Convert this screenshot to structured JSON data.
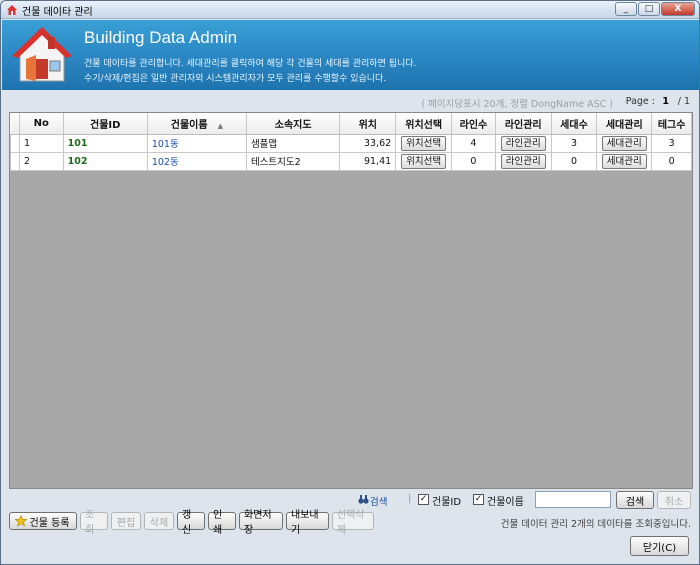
{
  "window": {
    "title": "건물 데이타 관리",
    "controls": [
      "_",
      "□",
      "X"
    ]
  },
  "banner": {
    "title": "Building Data Admin",
    "desc1": "건물 데이타를 관리합니다.  세대관리를 클릭하여 해당 각 건물의 세대를 관리하면 됩니다.",
    "desc2": "수기/삭제/편집은 일반 관리자외 시스템관리자가 모두 관리를 수행할수 있습니다."
  },
  "paging": {
    "sort_info": "( 페이지당표시 20개, 정렬 DongName ASC )",
    "page_label": "Page :",
    "current": "1",
    "total": "/  1"
  },
  "table": {
    "columns": [
      "No",
      "건물ID",
      "건물이름",
      "소속지도",
      "위치",
      "위치선택",
      "라인수",
      "라인관리",
      "세대수",
      "세대관리",
      "테그수"
    ],
    "sort_indicator": "▲",
    "rows": [
      {
        "no": "1",
        "id": "101",
        "name": "101동",
        "map": "샘플맵",
        "pos": "33,62",
        "pos_btn": "위치선택",
        "lines": "4",
        "line_btn": "라인관리",
        "units": "3",
        "unit_btn": "세대관리",
        "tags": "3"
      },
      {
        "no": "2",
        "id": "102",
        "name": "102동",
        "map": "테스트지도2",
        "pos": "91,41",
        "pos_btn": "위치선택",
        "lines": "0",
        "line_btn": "라인관리",
        "units": "0",
        "unit_btn": "세대관리",
        "tags": "0"
      }
    ]
  },
  "search": {
    "label": "검색",
    "pipe": "|",
    "opt_id": "건물ID",
    "opt_name": "건물이름",
    "check_mark": "✓",
    "value": "",
    "search_btn": "검색",
    "cancel_btn": "취소"
  },
  "toolbar": {
    "add": "건물 등록",
    "view": "조회",
    "edit": "편집",
    "delete": "삭제",
    "refresh": "갱신",
    "print": "인쇄",
    "save_screen": "화면저장",
    "export": "내보내기",
    "delete_selected": "선택삭제",
    "status": "건물 데이터 관리 2개의 데이타를 조회중입니다."
  },
  "footer": {
    "close": "닫기(C)"
  }
}
